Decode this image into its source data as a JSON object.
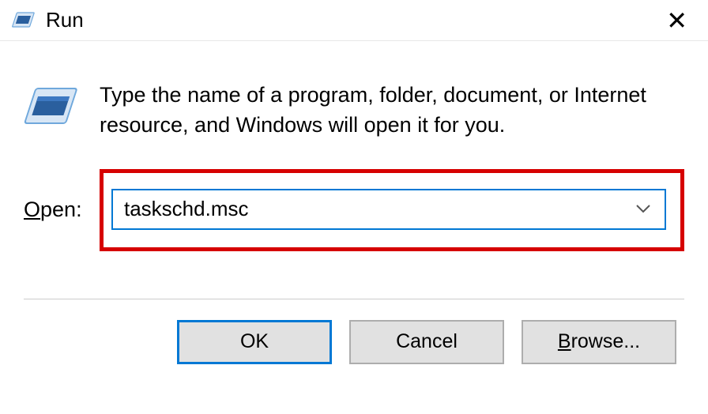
{
  "titlebar": {
    "title": "Run"
  },
  "dialog": {
    "description": "Type the name of a program, folder, document, or Internet resource, and Windows will open it for you.",
    "open_label_prefix": "O",
    "open_label_rest": "pen:",
    "input_value": "taskschd.msc"
  },
  "buttons": {
    "ok": "OK",
    "cancel": "Cancel",
    "browse_prefix": "B",
    "browse_rest": "rowse..."
  }
}
